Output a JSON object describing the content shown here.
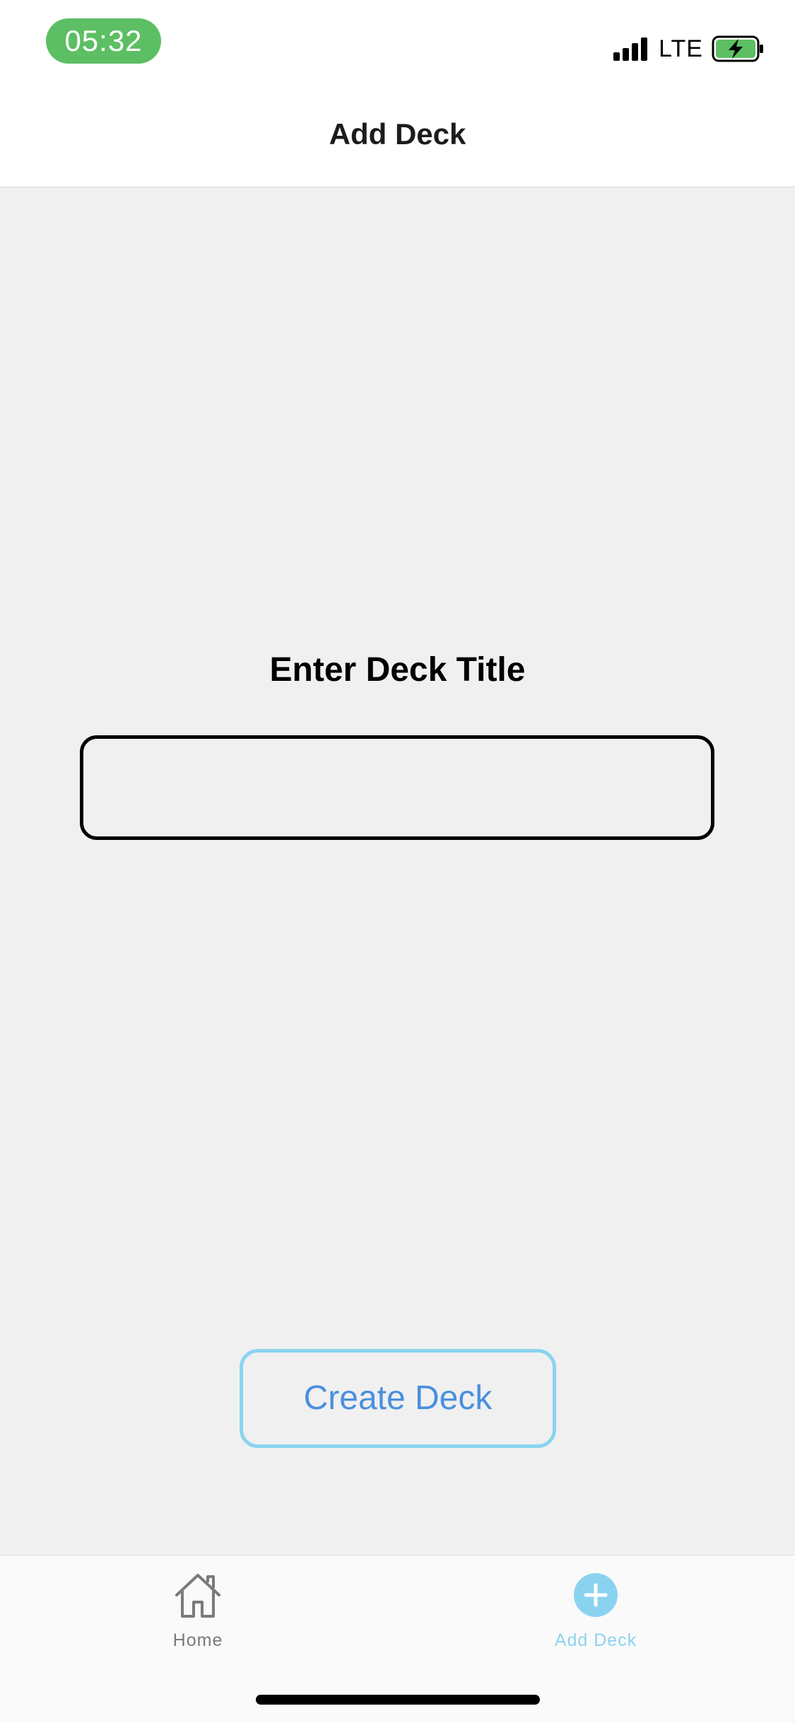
{
  "status_bar": {
    "time": "05:32",
    "network": "LTE",
    "signal_icon": "signal-bars-icon",
    "battery_icon": "battery-charging-icon",
    "time_pill_color": "#5cbf63"
  },
  "header": {
    "title": "Add Deck"
  },
  "form": {
    "prompt": "Enter Deck Title",
    "title_input_value": "",
    "title_input_placeholder": "",
    "submit_label": "Create Deck"
  },
  "tab_bar": {
    "tabs": [
      {
        "label": "Home",
        "icon": "home-icon",
        "active": false
      },
      {
        "label": "Add Deck",
        "icon": "plus-circle-icon",
        "active": true
      }
    ],
    "active_color": "#8ad3f0",
    "inactive_color": "#7a7a7a"
  }
}
